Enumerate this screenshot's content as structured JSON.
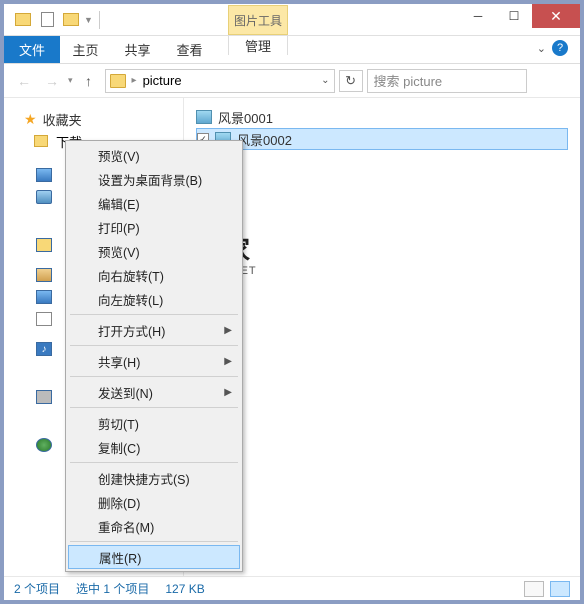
{
  "titlebar": {
    "contextual_tab": "图片工具"
  },
  "ribbon": {
    "file": "文件",
    "home": "主页",
    "share": "共享",
    "view": "查看",
    "manage": "管理"
  },
  "nav": {
    "path": "picture",
    "search_placeholder": "搜索 picture"
  },
  "sidebar": {
    "favorites": "收藏夹",
    "downloads": "下载"
  },
  "files": {
    "items": [
      {
        "name": "风景0001",
        "selected": false
      },
      {
        "name": "风景0002",
        "selected": true
      }
    ]
  },
  "context_menu": {
    "items": [
      {
        "label": "预览(V)",
        "type": "item"
      },
      {
        "label": "设置为桌面背景(B)",
        "type": "item"
      },
      {
        "label": "编辑(E)",
        "type": "item"
      },
      {
        "label": "打印(P)",
        "type": "item"
      },
      {
        "label": "预览(V)",
        "type": "item"
      },
      {
        "label": "向右旋转(T)",
        "type": "item"
      },
      {
        "label": "向左旋转(L)",
        "type": "item"
      },
      {
        "type": "sep"
      },
      {
        "label": "打开方式(H)",
        "type": "submenu"
      },
      {
        "type": "sep"
      },
      {
        "label": "共享(H)",
        "type": "submenu"
      },
      {
        "type": "sep"
      },
      {
        "label": "发送到(N)",
        "type": "submenu"
      },
      {
        "type": "sep"
      },
      {
        "label": "剪切(T)",
        "type": "item"
      },
      {
        "label": "复制(C)",
        "type": "item"
      },
      {
        "type": "sep"
      },
      {
        "label": "创建快捷方式(S)",
        "type": "item"
      },
      {
        "label": "删除(D)",
        "type": "item"
      },
      {
        "label": "重命名(M)",
        "type": "item"
      },
      {
        "type": "sep"
      },
      {
        "label": "属性(R)",
        "type": "item",
        "highlighted": true
      }
    ]
  },
  "statusbar": {
    "count": "2 个项目",
    "selection": "选中 1 个项目",
    "size": "127 KB"
  },
  "watermark": {
    "cn": "系统之家",
    "en": "XITONGZHIJIA.NET"
  }
}
